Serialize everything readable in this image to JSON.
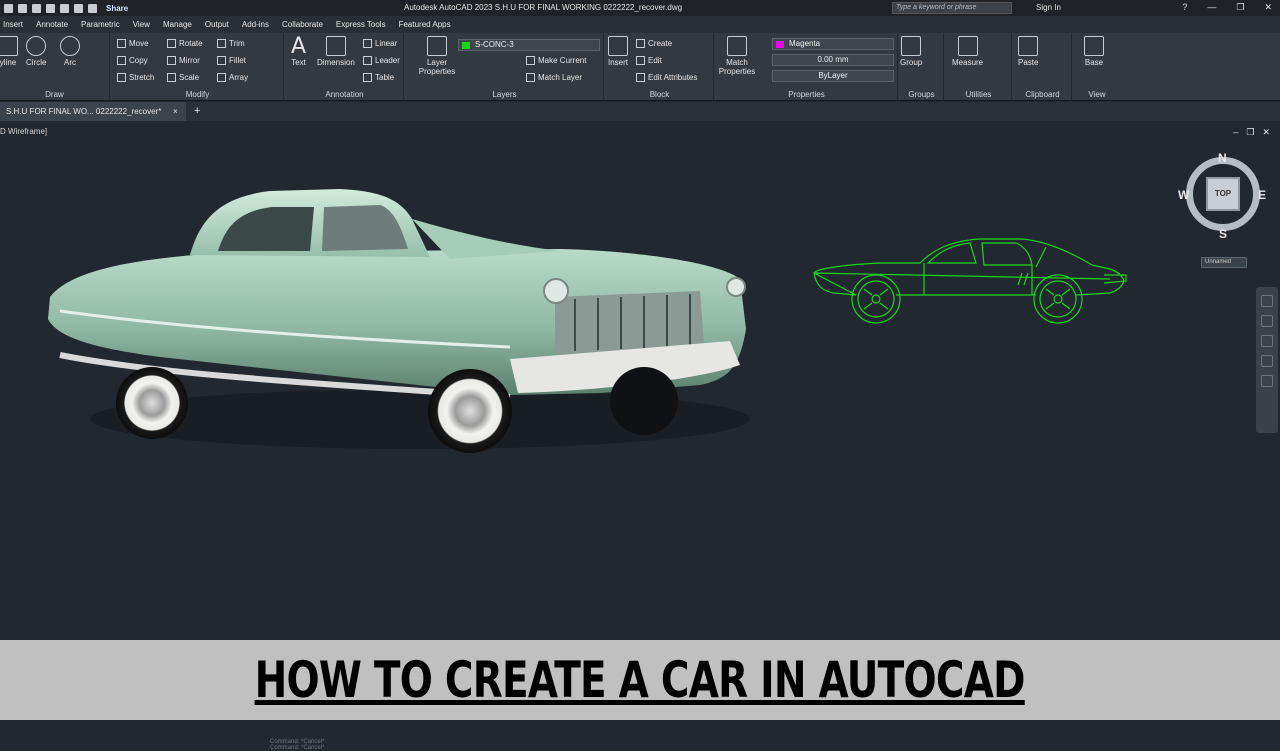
{
  "titlebar": {
    "share_label": "Share",
    "app_title": "Autodesk AutoCAD 2023   S.H.U FOR FINAL WORKING 0222222_recover.dwg",
    "search_placeholder": "Type a keyword or phrase",
    "sign_in": "Sign In",
    "help": "?"
  },
  "menubar": {
    "items": [
      "Insert",
      "Annotate",
      "Parametric",
      "View",
      "Manage",
      "Output",
      "Add-ins",
      "Collaborate",
      "Express Tools",
      "Featured Apps"
    ]
  },
  "ribbon": {
    "draw": {
      "label": "Draw",
      "polyline": "yline",
      "circle": "Circle",
      "arc": "Arc"
    },
    "modify": {
      "label": "Modify",
      "move": "Move",
      "rotate": "Rotate",
      "trim": "Trim",
      "copy": "Copy",
      "mirror": "Mirror",
      "fillet": "Fillet",
      "stretch": "Stretch",
      "scale": "Scale",
      "array": "Array"
    },
    "annotation": {
      "label": "Annotation",
      "text": "Text",
      "dimension": "Dimension",
      "linear": "Linear",
      "leader": "Leader",
      "table": "Table"
    },
    "layers": {
      "label": "Layers",
      "layer_properties": "Layer Properties",
      "current_layer": "S-CONC-3",
      "make_current": "Make Current",
      "match_layer": "Match Layer"
    },
    "block": {
      "label": "Block",
      "insert": "Insert",
      "create": "Create",
      "edit": "Edit",
      "edit_attributes": "Edit Attributes"
    },
    "properties": {
      "label": "Properties",
      "match_properties": "Match Properties",
      "color": "Magenta",
      "lineweight": "0.00 mm",
      "linetype": "ByLayer",
      "color_hex": "#ff00ff"
    },
    "groups": {
      "label": "Groups",
      "group": "Group"
    },
    "utilities": {
      "label": "Utilities",
      "measure": "Measure"
    },
    "clipboard": {
      "label": "Clipboard",
      "paste": "Paste"
    },
    "view": {
      "label": "View",
      "base": "Base"
    }
  },
  "doctabs": {
    "active_tab": "S.H.U FOR FINAL WO... 0222222_recover*",
    "close": "×",
    "new": "+"
  },
  "viewport": {
    "label": "D Wireframe]",
    "viewcube": {
      "top": "TOP",
      "n": "N",
      "s": "S",
      "e": "E",
      "w": "W"
    },
    "ucs_name": "Unnamed",
    "command_history": [
      "Command:  *Cancel*",
      "Command:  *Cancel*"
    ]
  },
  "banner": {
    "headline": "HOW TO CREATE A CAR IN AUTOCAD"
  },
  "colors": {
    "drawing_green": "#19d619",
    "car_body": "#9cc4b0"
  }
}
